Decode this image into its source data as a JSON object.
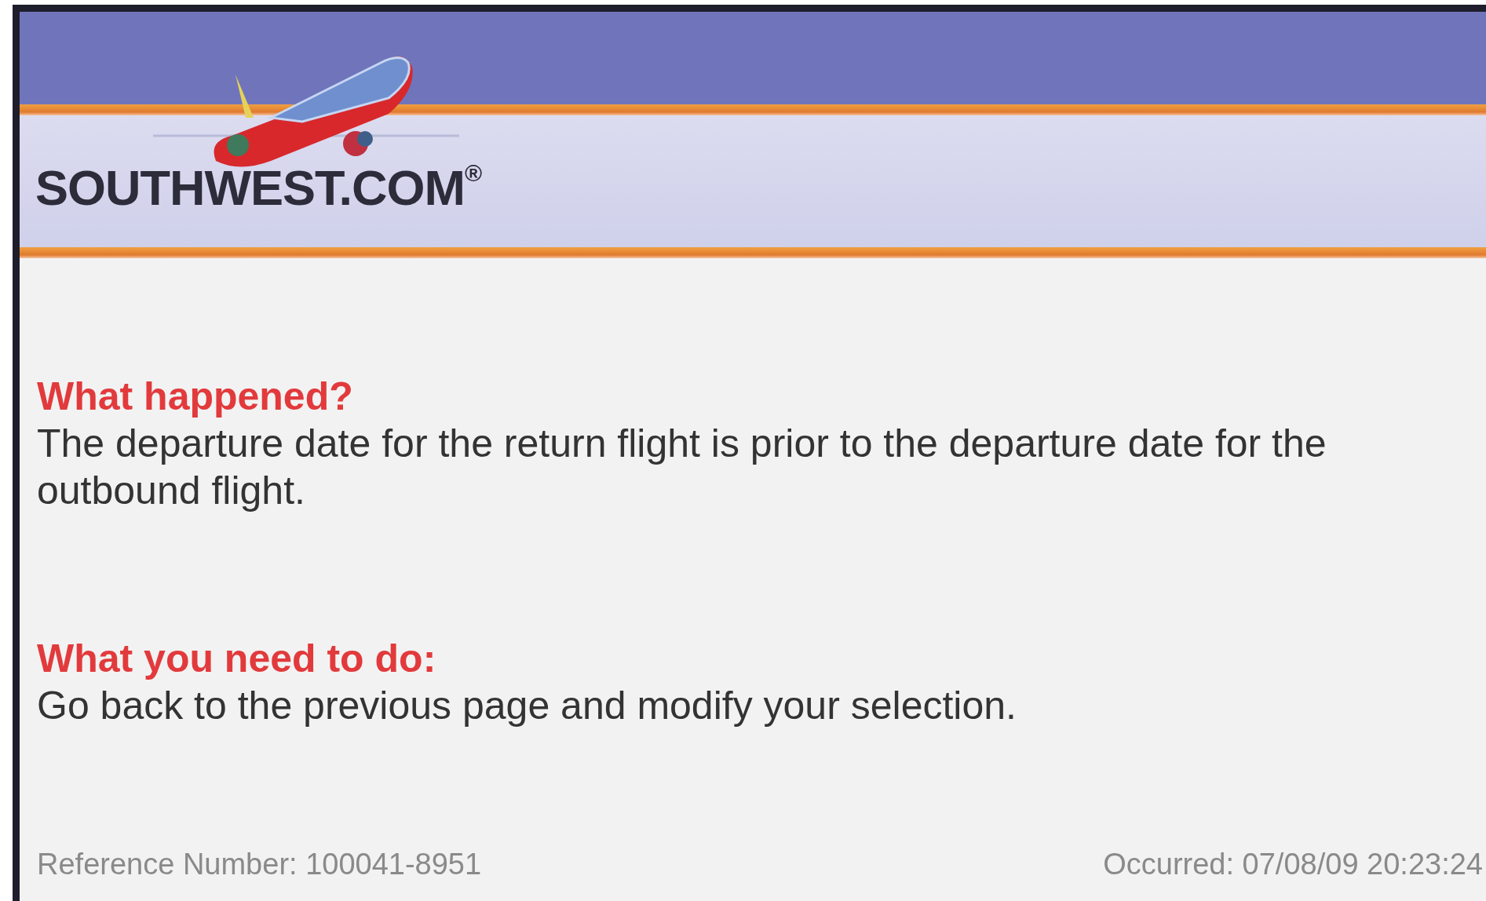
{
  "header": {
    "logo_text": "SOUTHWEST.COM$^{®}$"
  },
  "sections": [
    {
      "heading": "What happened?",
      "text": "The departure date for the return flight is prior to the departure date for the outbound flight."
    },
    {
      "heading": "What you need to do:",
      "text": "Go back to the previous page and modify your selection."
    }
  ],
  "footer": {
    "reference": "Reference Number: 100041-8951",
    "occurred": "Occurred:  07/08/09 20:23:24"
  }
}
